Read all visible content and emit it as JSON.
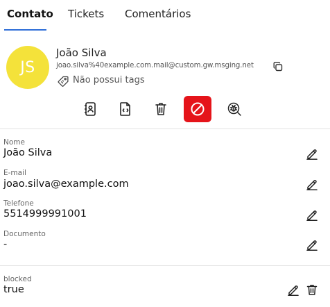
{
  "tabs": [
    {
      "label": "Contato",
      "active": true
    },
    {
      "label": "Tickets",
      "active": false
    },
    {
      "label": "Comentários",
      "active": false
    }
  ],
  "contact": {
    "initials": "JS",
    "name": "João Silva",
    "email": "joao.silva%40example.com.mail@custom.gw.msging.net",
    "tags_label": "Não possui tags",
    "avatar_color": "#f4e23a"
  },
  "actions": [
    {
      "name": "contact-card-button",
      "icon": "contact-card-icon"
    },
    {
      "name": "code-file-button",
      "icon": "code-file-icon"
    },
    {
      "name": "delete-contact-button",
      "icon": "trash-icon"
    },
    {
      "name": "block-contact-button",
      "icon": "block-icon",
      "color": "#e5141a"
    },
    {
      "name": "bug-search-button",
      "icon": "bug-search-icon"
    }
  ],
  "fields": [
    {
      "label": "Nome",
      "value": "João Silva"
    },
    {
      "label": "E-mail",
      "value": "joao.silva@example.com"
    },
    {
      "label": "Telefone",
      "value": "5514999991001"
    },
    {
      "label": "Documento",
      "value": "-"
    }
  ],
  "extras": [
    {
      "label": "blocked",
      "value": "true"
    }
  ],
  "colors": {
    "accent": "#2f6fd8",
    "danger": "#e5141a"
  }
}
